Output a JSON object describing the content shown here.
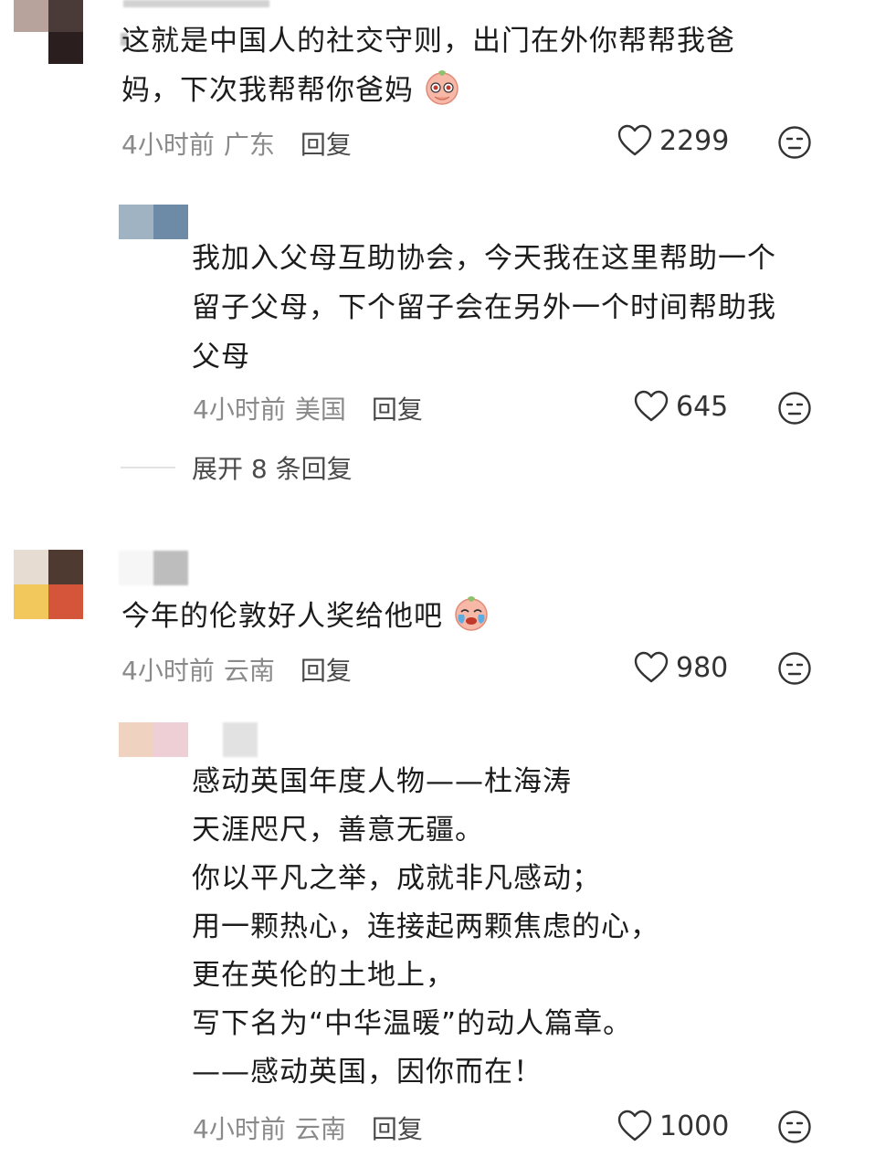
{
  "comments": [
    {
      "text_line1": "这就是中国人的社交守则，出门在外你帮帮我爸",
      "text_line2": "妈，下次我帮帮你爸妈",
      "emoji": "crying-pleading-emoji",
      "time": "4小时前",
      "region": "广东",
      "reply_label": "回复",
      "likes": "2299"
    },
    {
      "text_line1": "我加入父母互助协会，今天我在这里帮助一个",
      "text_line2": "留子父母，下个留子会在另外一个时间帮助我",
      "text_line3": "父母",
      "time": "4小时前",
      "region": "美国",
      "reply_label": "回复",
      "likes": "645",
      "expand_label": "展开 8 条回复"
    },
    {
      "text_line1": "今年的伦敦好人奖给他吧",
      "emoji": "crying-emoji",
      "time": "4小时前",
      "region": "云南",
      "reply_label": "回复",
      "likes": "980"
    },
    {
      "lines": [
        "感动英国年度人物——杜海涛",
        "天涯咫尺，善意无疆。",
        "你以平凡之举，成就非凡感动；",
        "用一颗热心，连接起两颗焦虑的心，",
        "更在英伦的土地上，",
        "写下名为“中华温暖”的动人篇章。",
        "——感动英国，因你而在！"
      ],
      "time": "4小时前",
      "region": "云南",
      "reply_label": "回复",
      "likes": "1000"
    }
  ],
  "colors": {
    "text": "#1c1c1c",
    "meta": "#8a8a8a",
    "reply": "#4a4a4a"
  }
}
